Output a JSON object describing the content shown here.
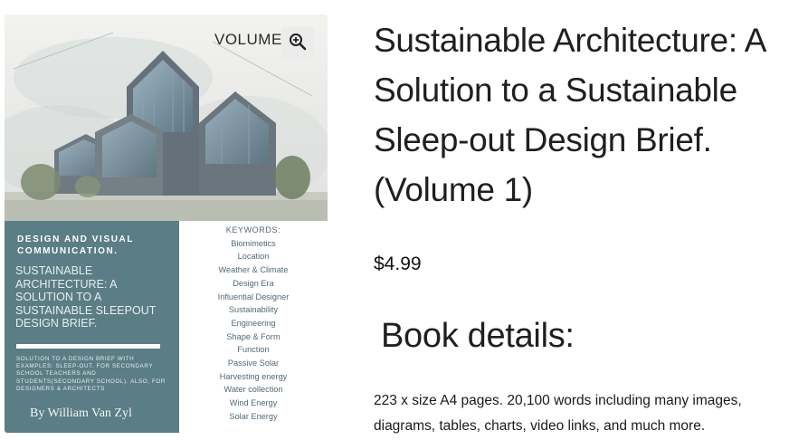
{
  "cover": {
    "volume_label": "VOLUME",
    "header": "DESIGN AND VISUAL\nCOMMUNICATION.",
    "title": "SUSTAINABLE ARCHITECTURE: A SOLUTION TO A SUSTAINABLE SLEEPOUT DESIGN BRIEF.",
    "subtitle": "SOLUTION TO A DESIGN BRIEF WITH EXAMPLES: SLEEP-OUT. FOR SECONDARY SCHOOL TEACHERS AND STUDENTS(SECONDARY SCHOOL). ALSO, FOR DESIGNERS & ARCHITECTS",
    "author": "By William Van Zyl",
    "keywords_heading": "KEYWORDS:",
    "keywords": [
      "Biomimetics",
      "Location",
      "Weather & Climate",
      "Design Era",
      "Influential Designer",
      "Sustainability",
      "Engineering",
      "Shape & Form",
      "Function",
      "Passive Solar",
      "Harvesting energy",
      "Water collection",
      "Wind Energy",
      "Solar Energy"
    ],
    "colors": {
      "panel": "#5b7d85",
      "keyword_text": "#4f6b74"
    }
  },
  "zoom_icon": "magnifier-plus-icon",
  "product": {
    "title": "Sustainable Architecture: A Solution to a Sustainable Sleep-out Design Brief. (Volume 1)",
    "price": "$4.99",
    "details_heading": "Book details:",
    "details_text": "223 x size A4 pages. 20,100 words including many images, diagrams, tables, charts, video links, and much more."
  }
}
